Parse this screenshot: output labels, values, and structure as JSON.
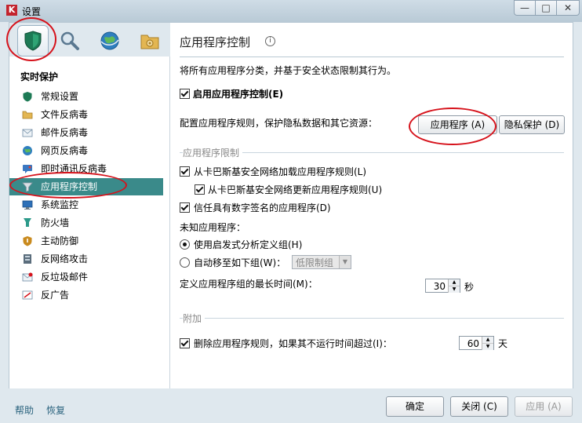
{
  "window": {
    "title": "设置",
    "app_icon_letter": "K",
    "min_glyph": "—",
    "max_glyph": "□",
    "close_glyph": "✕"
  },
  "toolbar_tabs": [
    {
      "name": "protection",
      "icon": "shield-icon",
      "selected": true
    },
    {
      "name": "scan",
      "icon": "magnifier-icon",
      "selected": false
    },
    {
      "name": "update",
      "icon": "globe-icon",
      "selected": false
    },
    {
      "name": "options",
      "icon": "folder-gear-icon",
      "selected": false
    }
  ],
  "sidebar": {
    "header": "实时保护",
    "items": [
      {
        "label": "常规设置",
        "icon": "shield-icon"
      },
      {
        "label": "文件反病毒",
        "icon": "folder-icon"
      },
      {
        "label": "邮件反病毒",
        "icon": "mail-icon"
      },
      {
        "label": "网页反病毒",
        "icon": "globe-icon"
      },
      {
        "label": "即时通讯反病毒",
        "icon": "chat-icon"
      },
      {
        "label": "应用程序控制",
        "icon": "funnel-icon",
        "selected": true
      },
      {
        "label": "系统监控",
        "icon": "monitor-icon"
      },
      {
        "label": "防火墙",
        "icon": "firewall-icon"
      },
      {
        "label": "主动防御",
        "icon": "shield-alert-icon"
      },
      {
        "label": "反网络攻击",
        "icon": "network-icon"
      },
      {
        "label": "反垃圾邮件",
        "icon": "spam-mail-icon"
      },
      {
        "label": "反广告",
        "icon": "ad-block-icon"
      }
    ]
  },
  "content": {
    "title": "应用程序控制",
    "info_glyph": "i",
    "description": "将所有应用程序分类，并基于安全状态限制其行为。",
    "enable_label": "启用应用程序控制(E)",
    "configure_label": "配置应用程序规则，保护隐私数据和其它资源：",
    "applications_button": "应用程序 (A)",
    "privacy_button": "隐私保护 (D)",
    "group_restrictions": "应用程序限制",
    "load_rules": "从卡巴斯基安全网络加载应用程序规则(L)",
    "update_rules": "从卡巴斯基安全网络更新应用程序规则(U)",
    "trust_signed": "信任具有数字签名的应用程序(D)",
    "unknown_apps": "未知应用程序：",
    "use_heuristic": "使用启发式分析定义组(H)",
    "auto_move": "自动移至如下组(W)：",
    "group_select": "低限制组",
    "max_time_label": "定义应用程序组的最长时间(M)：",
    "max_time_value": "30",
    "max_time_unit": "秒",
    "group_additional": "附加",
    "delete_rules": "删除应用程序规则，如果其不运行时间超过(I)：",
    "delete_days_value": "60",
    "delete_days_unit": "天"
  },
  "footer": {
    "help": "帮助",
    "restore": "恢复",
    "ok": "确定",
    "close": "关闭 (C)",
    "apply": "应用 (A)"
  },
  "colors": {
    "accent_selected": "#3a8a8a",
    "annotation": "#d6121b",
    "link": "#29627d"
  }
}
